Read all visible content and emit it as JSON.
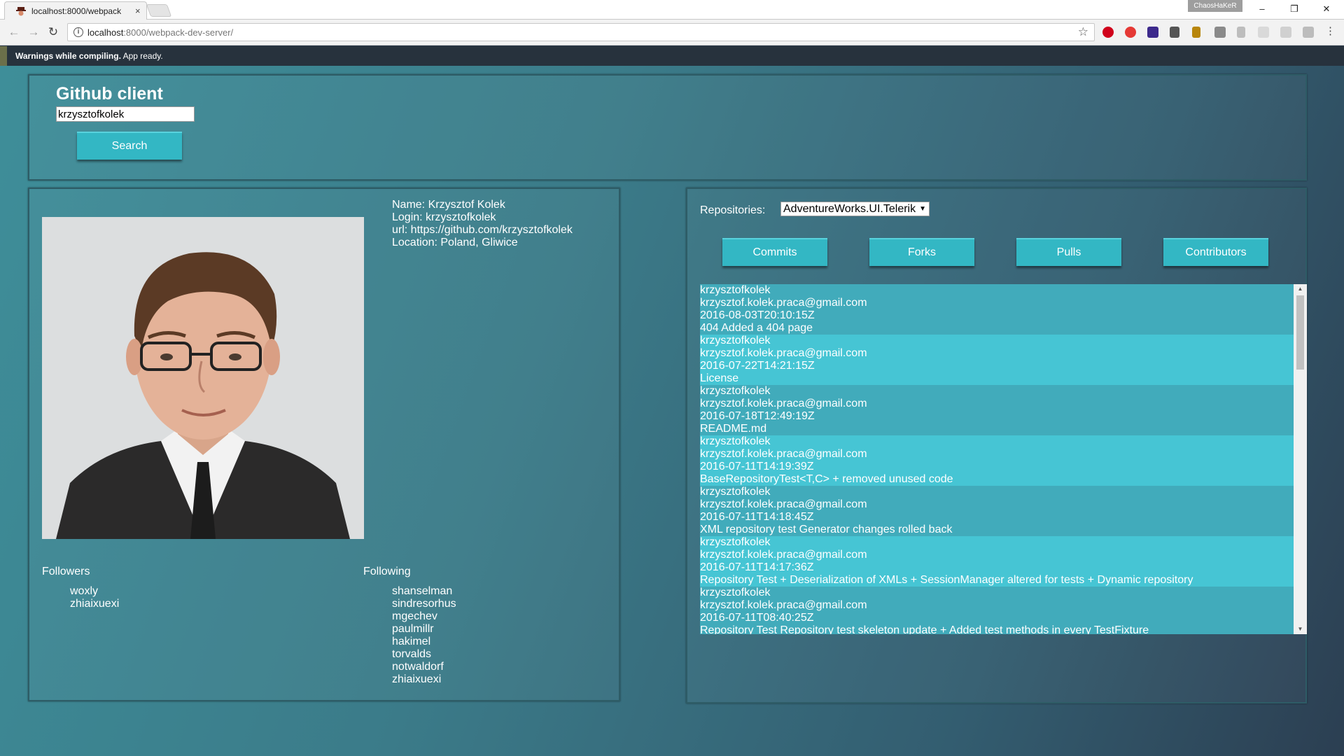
{
  "browser": {
    "tab_title": "localhost:8000/webpack",
    "tab_close": "×",
    "profile_name": "ChaosHaKeR",
    "url_host": "localhost",
    "url_rest": ":8000/webpack-dev-server/",
    "window_minimize": "–",
    "window_restore": "❐",
    "window_close": "✕"
  },
  "dev_status": {
    "bold": "Warnings while compiling.",
    "rest": " App ready."
  },
  "search": {
    "title": "Github client",
    "username_value": "krzysztofkolek",
    "button_label": "Search"
  },
  "user": {
    "name_line": "Name: Krzysztof Kolek",
    "login_line": "Login: krzysztofkolek",
    "url_line": "url: https://github.com/krzysztofkolek",
    "location_line": "Location: Poland, Gliwice",
    "followers_title": "Followers",
    "followers": [
      "woxly",
      "zhiaixuexi"
    ],
    "following_title": "Following",
    "following": [
      "shanselman",
      "sindresorhus",
      "mgechev",
      "paulmillr",
      "hakimel",
      "torvalds",
      "notwaldorf",
      "zhiaixuexi"
    ]
  },
  "repos": {
    "label": "Repositories:",
    "selected": "AdventureWorks.UI.Telerik",
    "tabs": [
      "Commits",
      "Forks",
      "Pulls",
      "Contributors"
    ]
  },
  "commits": [
    {
      "author": "krzysztofkolek",
      "email": "krzysztof.kolek.praca@gmail.com",
      "date": "2016-08-03T20:10:15Z",
      "message": "404 Added a 404 page"
    },
    {
      "author": "krzysztofkolek",
      "email": "krzysztof.kolek.praca@gmail.com",
      "date": "2016-07-22T14:21:15Z",
      "message": "License"
    },
    {
      "author": "krzysztofkolek",
      "email": "krzysztof.kolek.praca@gmail.com",
      "date": "2016-07-18T12:49:19Z",
      "message": "README.md"
    },
    {
      "author": "krzysztofkolek",
      "email": "krzysztof.kolek.praca@gmail.com",
      "date": "2016-07-11T14:19:39Z",
      "message": "BaseRepositoryTest<T,C> + removed unused code"
    },
    {
      "author": "krzysztofkolek",
      "email": "krzysztof.kolek.praca@gmail.com",
      "date": "2016-07-11T14:18:45Z",
      "message": "XML repository test Generator changes rolled back"
    },
    {
      "author": "krzysztofkolek",
      "email": "krzysztof.kolek.praca@gmail.com",
      "date": "2016-07-11T14:17:36Z",
      "message": "Repository Test + Deserialization of XMLs + SessionManager altered for tests + Dynamic repository"
    },
    {
      "author": "krzysztofkolek",
      "email": "krzysztof.kolek.praca@gmail.com",
      "date": "2016-07-11T08:40:25Z",
      "message": "Repository Test Repository test skeleton update + Added test methods in every TestFixture"
    }
  ]
}
